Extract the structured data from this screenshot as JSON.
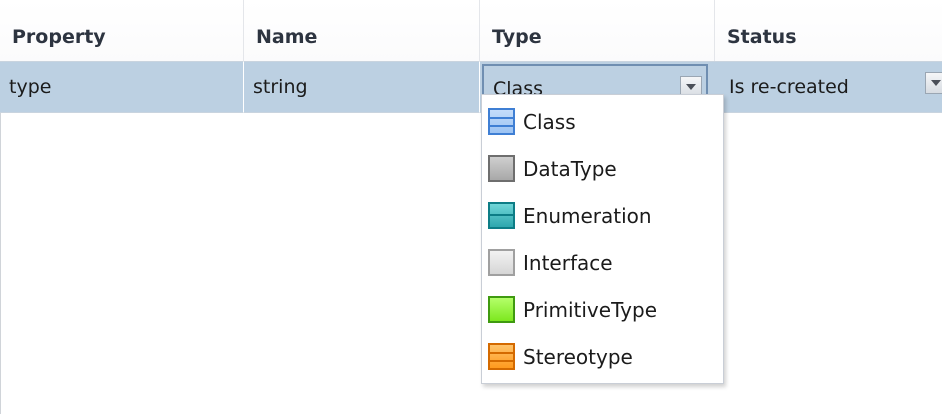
{
  "header": {
    "columns": [
      "Property",
      "Name",
      "Type",
      "Status"
    ]
  },
  "row": {
    "property": "type",
    "name": "string",
    "type_value": "Class",
    "status_value": "Is re-created"
  },
  "type_dropdown": {
    "options": [
      {
        "label": "Class",
        "icon": "class-icon"
      },
      {
        "label": "DataType",
        "icon": "datatype-icon"
      },
      {
        "label": "Enumeration",
        "icon": "enumeration-icon"
      },
      {
        "label": "Interface",
        "icon": "interface-icon"
      },
      {
        "label": "PrimitiveType",
        "icon": "primitive-type-icon"
      },
      {
        "label": "Stereotype",
        "icon": "stereotype-icon"
      }
    ]
  },
  "colors": {
    "selected_row": "#bcd0e2",
    "combo_border": "#6f8eb1",
    "class_icon": "#3f7fd4",
    "enumeration_icon": "#0d7d86",
    "primitive_type_icon": "#7de81f",
    "stereotype_icon": "#ff9a1e"
  }
}
